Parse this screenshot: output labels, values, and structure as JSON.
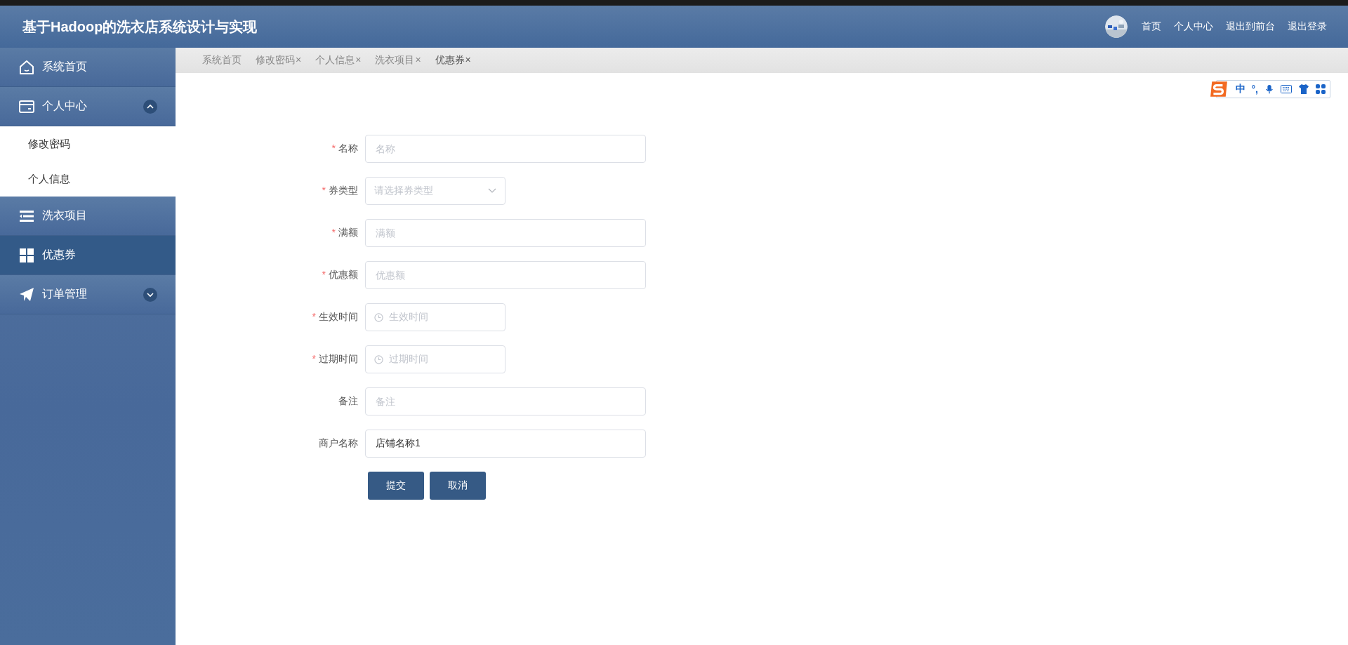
{
  "header": {
    "title": "基于Hadoop的洗衣店系统设计与实现",
    "nav": [
      "首页",
      "个人中心",
      "退出到前台",
      "退出登录"
    ]
  },
  "sidebar": {
    "items": [
      {
        "label": "系统首页",
        "kind": "home",
        "selected": false
      },
      {
        "label": "个人中心",
        "kind": "wallet",
        "selected": false,
        "expanded": true,
        "children": [
          {
            "label": "修改密码",
            "selected": false
          },
          {
            "label": "个人信息",
            "selected": false
          }
        ]
      },
      {
        "label": "洗衣项目",
        "kind": "list",
        "selected": false
      },
      {
        "label": "优惠券",
        "kind": "grid",
        "selected": true
      },
      {
        "label": "订单管理",
        "kind": "send",
        "selected": false,
        "expanded": false
      }
    ]
  },
  "tabs": [
    {
      "label": "系统首页",
      "selected": false
    },
    {
      "label": "修改密码",
      "close": "×",
      "selected": false
    },
    {
      "label": "个人信息",
      "close": "×",
      "selected": false
    },
    {
      "label": "洗衣项目",
      "close": "×",
      "selected": false
    },
    {
      "label": "优惠券",
      "close": "×",
      "selected": true
    }
  ],
  "ime_toolbar": {
    "mode": "中",
    "punctuation": "°,"
  },
  "form": {
    "fields": [
      {
        "label": "名称",
        "marker": "*",
        "kind": "text",
        "placeholder": "名称"
      },
      {
        "label": "券类型",
        "marker": "*",
        "kind": "select",
        "placeholder": "请选择券类型"
      },
      {
        "label": "满额",
        "marker": "*",
        "kind": "text",
        "placeholder": "满额"
      },
      {
        "label": "优惠额",
        "marker": "*",
        "kind": "text",
        "placeholder": "优惠额"
      },
      {
        "label": "生效时间",
        "marker": "*",
        "kind": "date",
        "placeholder": "生效时间"
      },
      {
        "label": "过期时间",
        "marker": "*",
        "kind": "date",
        "placeholder": "过期时间"
      },
      {
        "label": "备注",
        "kind": "text",
        "placeholder": "备注"
      },
      {
        "label": "商户名称",
        "kind": "text",
        "value": "店铺名称1"
      }
    ],
    "buttons": [
      "提交",
      "取消"
    ]
  }
}
